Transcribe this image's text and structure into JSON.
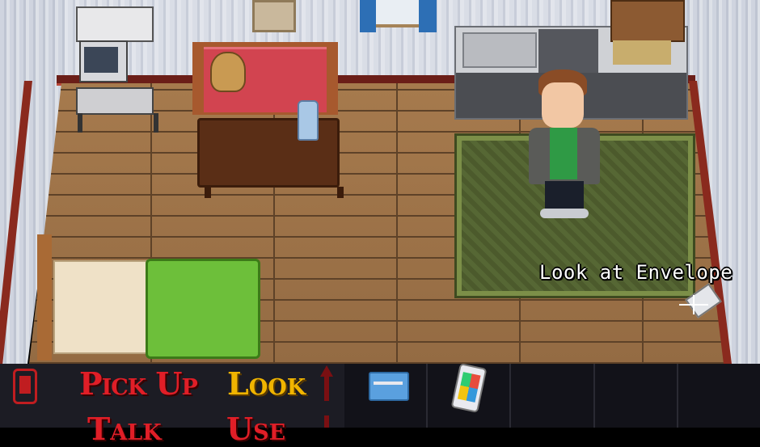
{
  "hover_action": "Look at Envelope",
  "verbs": {
    "pick_up": "Pick Up",
    "look": "Look",
    "talk": "Talk",
    "use": "Use"
  },
  "inventory": {
    "slots": [
      {
        "item": "credit-card"
      },
      {
        "item": "smartphone"
      },
      {
        "item": ""
      },
      {
        "item": ""
      },
      {
        "item": ""
      }
    ]
  },
  "colors": {
    "verb_default": "#e01e27",
    "verb_selected": "#f0b400",
    "ui_background": "#1c1c24"
  }
}
